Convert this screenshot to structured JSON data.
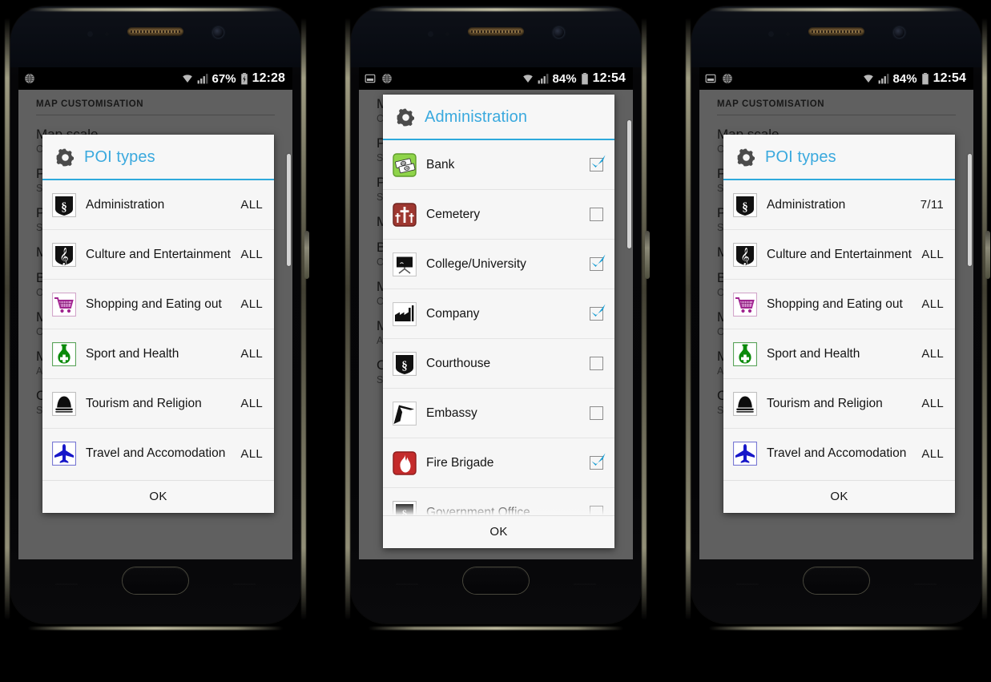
{
  "app": {
    "settings_section_title": "MAP CUSTOMISATION"
  },
  "icons": {
    "gear": "gear-icon",
    "wifi": "wifi-icon",
    "signal": "signal-bars-icon",
    "battery": "battery-icon",
    "screenshot": "screenshot-icon",
    "globe": "globe-icon"
  },
  "settings_background": {
    "rows": [
      {
        "title": "Map scale",
        "sub": "Compact"
      },
      {
        "title": "POI types",
        "sub": "Show points of interest on the map"
      },
      {
        "title": "POI labels",
        "sub": "Show names"
      },
      {
        "title": "Map style",
        "sub": ""
      },
      {
        "title": "Buildings",
        "sub": "On"
      },
      {
        "title": "Map language",
        "sub": "Object names"
      },
      {
        "title": "Map rotation",
        "sub": "Auto"
      },
      {
        "title": "Contour lines",
        "sub": "Show"
      }
    ]
  },
  "phones": [
    {
      "id": "phone-1",
      "status": {
        "time": "12:28",
        "battery_percent": "67%",
        "charging": true
      },
      "dialog": {
        "title": "POI types",
        "ok_label": "OK",
        "type": "categories",
        "rows": [
          {
            "label": "Administration",
            "value": "ALL",
            "icon": "administration-icon"
          },
          {
            "label": "Culture and Entertainment",
            "value": "ALL",
            "icon": "culture-icon"
          },
          {
            "label": "Shopping and Eating out",
            "value": "ALL",
            "icon": "shopping-icon"
          },
          {
            "label": "Sport and Health",
            "value": "ALL",
            "icon": "sport-health-icon"
          },
          {
            "label": "Tourism and Religion",
            "value": "ALL",
            "icon": "tourism-icon"
          },
          {
            "label": "Travel and Accomodation",
            "value": "ALL",
            "icon": "travel-icon"
          }
        ]
      }
    },
    {
      "id": "phone-2",
      "status": {
        "time": "12:54",
        "battery_percent": "84%",
        "charging": false
      },
      "dialog": {
        "title": "Administration",
        "ok_label": "OK",
        "type": "checkboxes",
        "rows": [
          {
            "label": "Bank",
            "checked": true,
            "icon": "bank-icon"
          },
          {
            "label": "Cemetery",
            "checked": false,
            "icon": "cemetery-icon"
          },
          {
            "label": "College/University",
            "checked": true,
            "icon": "college-icon"
          },
          {
            "label": "Company",
            "checked": true,
            "icon": "company-icon"
          },
          {
            "label": "Courthouse",
            "checked": false,
            "icon": "courthouse-icon"
          },
          {
            "label": "Embassy",
            "checked": false,
            "icon": "embassy-icon"
          },
          {
            "label": "Fire Brigade",
            "checked": true,
            "icon": "fire-brigade-icon"
          },
          {
            "label": "Government Office",
            "checked": false,
            "icon": "government-office-icon"
          }
        ]
      }
    },
    {
      "id": "phone-3",
      "status": {
        "time": "12:54",
        "battery_percent": "84%",
        "charging": false
      },
      "dialog": {
        "title": "POI types",
        "ok_label": "OK",
        "type": "categories",
        "rows": [
          {
            "label": "Administration",
            "value": "7/11",
            "icon": "administration-icon"
          },
          {
            "label": "Culture and Entertainment",
            "value": "ALL",
            "icon": "culture-icon"
          },
          {
            "label": "Shopping and Eating out",
            "value": "ALL",
            "icon": "shopping-icon"
          },
          {
            "label": "Sport and Health",
            "value": "ALL",
            "icon": "sport-health-icon"
          },
          {
            "label": "Tourism and Religion",
            "value": "ALL",
            "icon": "tourism-icon"
          },
          {
            "label": "Travel and Accomodation",
            "value": "ALL",
            "icon": "travel-icon"
          }
        ]
      }
    }
  ],
  "colors": {
    "accent": "#3aa9de",
    "accent_rule": "#2eaadc",
    "dialog_bg": "#f7f7f7",
    "screen_bg": "#6e6e6e",
    "statusbar_bg": "#000000"
  }
}
